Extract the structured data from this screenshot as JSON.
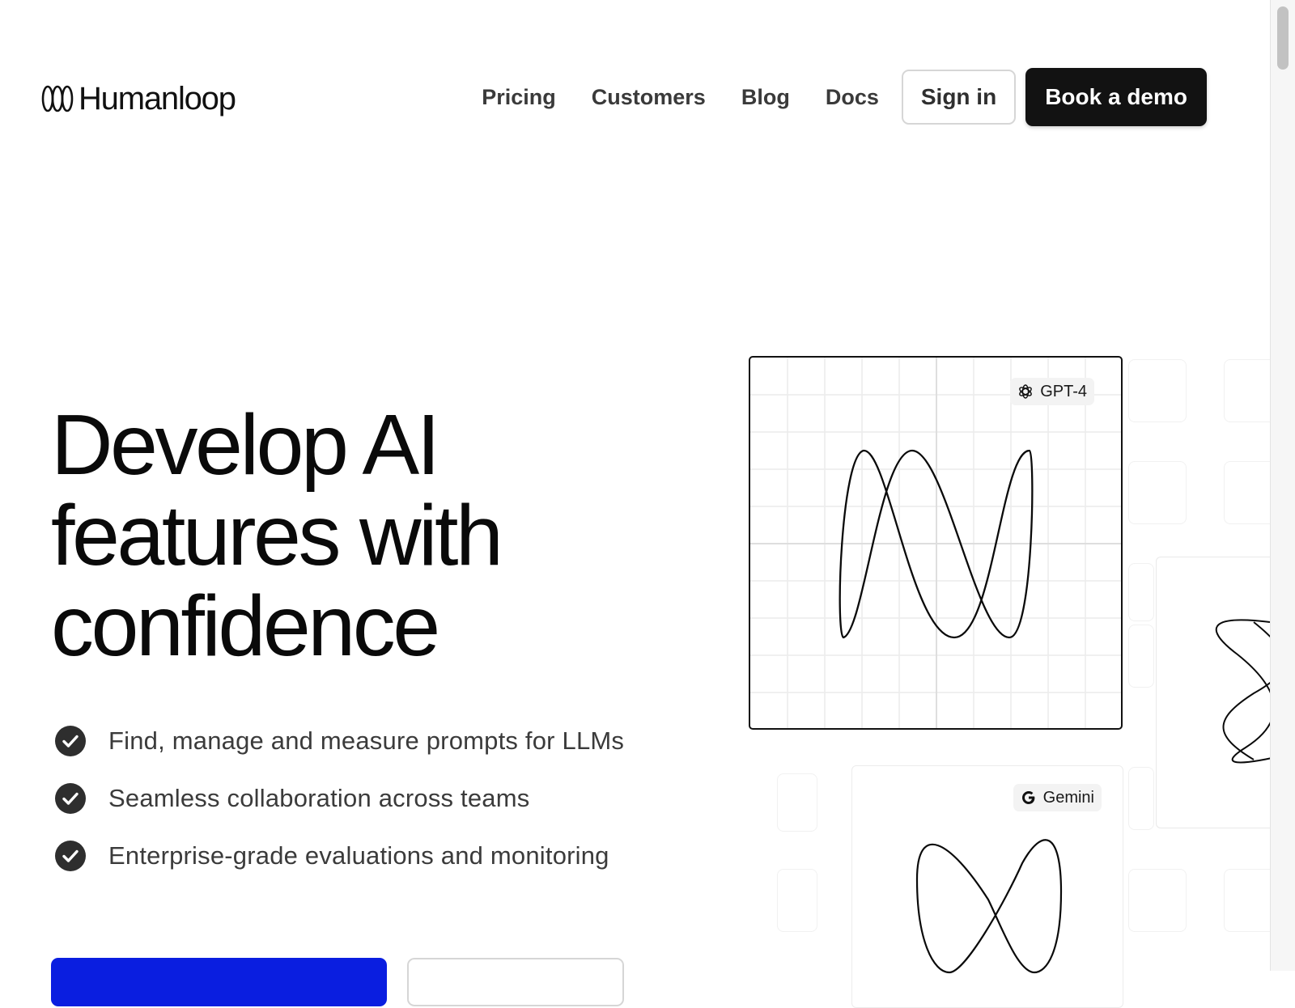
{
  "header": {
    "brand": "Humanloop",
    "nav": [
      {
        "label": "Pricing"
      },
      {
        "label": "Customers"
      },
      {
        "label": "Blog"
      },
      {
        "label": "Docs"
      }
    ],
    "sign_in_label": "Sign in",
    "book_demo_label": "Book a demo"
  },
  "hero": {
    "title": "Develop AI features with confidence",
    "features": [
      "Find, manage and measure prompts for LLMs",
      "Seamless collaboration across teams",
      "Enterprise-grade evaluations and monitoring"
    ]
  },
  "visual": {
    "cards": [
      {
        "model": "GPT-4",
        "icon": "openai-icon"
      },
      {
        "model": "Gemini",
        "icon": "google-icon"
      }
    ]
  },
  "colors": {
    "primary_cta": "#0a1ee0",
    "dark_button": "#121212",
    "text": "#0a0a0a"
  }
}
